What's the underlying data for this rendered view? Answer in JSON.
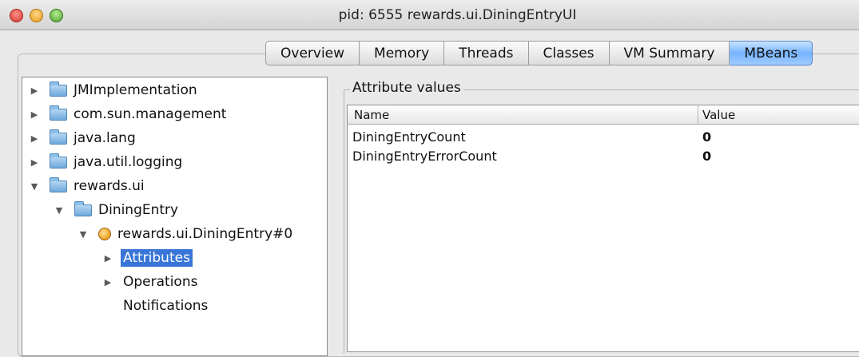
{
  "window": {
    "title": "pid: 6555 rewards.ui.DiningEntryUI"
  },
  "tabs": [
    {
      "label": "Overview"
    },
    {
      "label": "Memory"
    },
    {
      "label": "Threads"
    },
    {
      "label": "Classes"
    },
    {
      "label": "VM Summary"
    },
    {
      "label": "MBeans",
      "active": true
    }
  ],
  "tree": {
    "nodes": [
      {
        "label": "JMImplementation",
        "expander": "collapsed",
        "icon": "folder-icon"
      },
      {
        "label": "com.sun.management",
        "expander": "collapsed",
        "icon": "folder-icon"
      },
      {
        "label": "java.lang",
        "expander": "collapsed",
        "icon": "folder-icon"
      },
      {
        "label": "java.util.logging",
        "expander": "collapsed",
        "icon": "folder-icon"
      },
      {
        "label": "rewards.ui",
        "expander": "expanded",
        "icon": "folder-icon"
      },
      {
        "label": "DiningEntry",
        "expander": "expanded",
        "icon": "folder-icon"
      },
      {
        "label": "rewards.ui.DiningEntry#0",
        "expander": "expanded",
        "icon": "mbean-icon"
      },
      {
        "label": "Attributes",
        "expander": "collapsed",
        "icon": "",
        "selected": true
      },
      {
        "label": "Operations",
        "expander": "collapsed",
        "icon": ""
      },
      {
        "label": "Notifications",
        "expander": "none",
        "icon": ""
      }
    ]
  },
  "attributes": {
    "title": "Attribute values",
    "columns": {
      "name": "Name",
      "value": "Value"
    },
    "rows": [
      {
        "name": "DiningEntryCount",
        "value": "0"
      },
      {
        "name": "DiningEntryErrorCount",
        "value": "0"
      }
    ]
  },
  "colors": {
    "selection": "#3875d7",
    "active_tab": "#77b4ff"
  }
}
